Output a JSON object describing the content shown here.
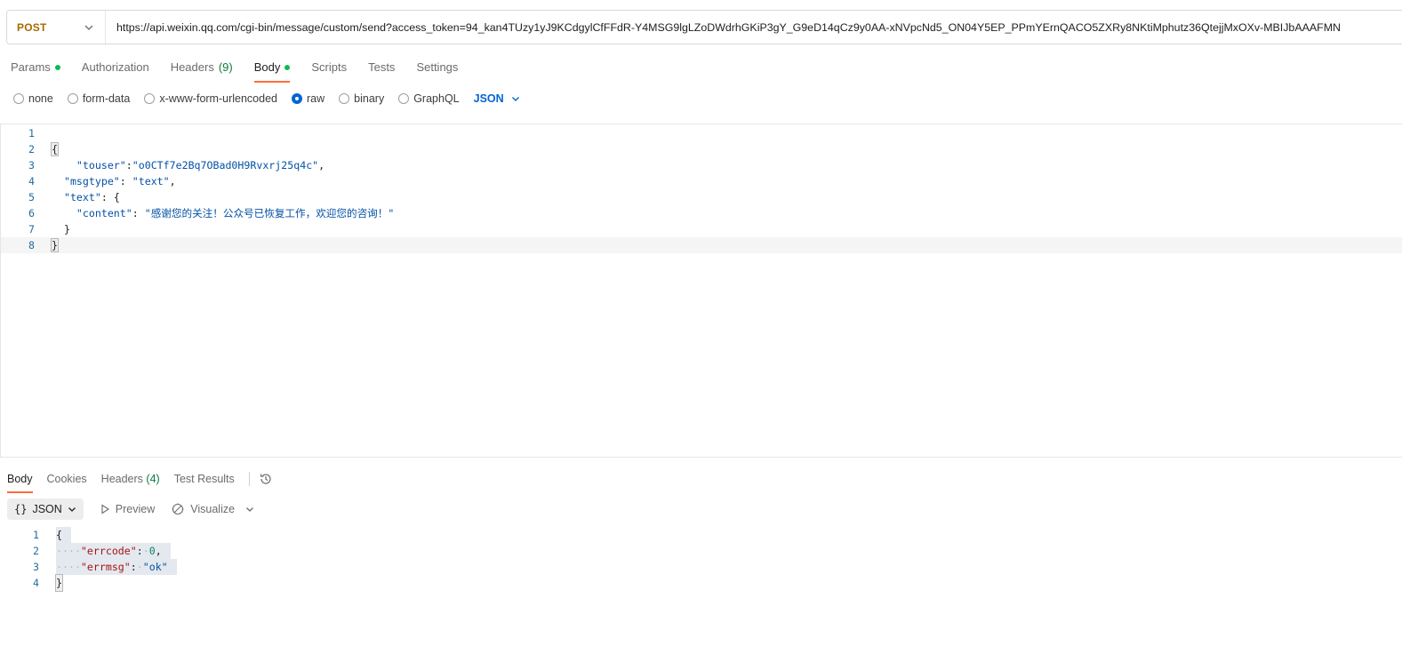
{
  "request": {
    "method": "POST",
    "url": "https://api.weixin.qq.com/cgi-bin/message/custom/send?access_token=94_kan4TUzy1yJ9KCdgylCfFFdR-Y4MSG9lgLZoDWdrhGKiP3gY_G9eD14qCz9y0AA-xNVpcNd5_ON04Y5EP_PPmYErnQACO5ZXRy8NKtiMphutz36QtejjMxOXv-MBIJbAAAFMN"
  },
  "request_tabs": [
    {
      "label": "Params",
      "dot": true
    },
    {
      "label": "Authorization"
    },
    {
      "label": "Headers",
      "count": "(9)"
    },
    {
      "label": "Body",
      "dot": true,
      "active": true
    },
    {
      "label": "Scripts"
    },
    {
      "label": "Tests"
    },
    {
      "label": "Settings"
    }
  ],
  "body_types": {
    "options": [
      "none",
      "form-data",
      "x-www-form-urlencoded",
      "raw",
      "binary",
      "GraphQL"
    ],
    "selected": "raw",
    "format": "JSON"
  },
  "editor": {
    "line_numbers": [
      "1",
      "2",
      "3",
      "4",
      "5",
      "6",
      "7",
      "8"
    ],
    "line3": {
      "key": "\"touser\"",
      "value": "\"o0CTf7e2Bq7OBad0H9Rvxrj25q4c\""
    },
    "line4": {
      "key": "\"msgtype\"",
      "value": "\"text\""
    },
    "line5": {
      "key": "\"text\""
    },
    "line6": {
      "key": "\"content\"",
      "value": "\"感谢您的关注！公众号已恢复工作，欢迎您的咨询！\""
    }
  },
  "response_tabs": [
    {
      "label": "Body",
      "active": true
    },
    {
      "label": "Cookies"
    },
    {
      "label": "Headers",
      "count": "(4)"
    },
    {
      "label": "Test Results"
    }
  ],
  "response_toolbar": {
    "format": "JSON",
    "preview": "Preview",
    "visualize": "Visualize"
  },
  "response": {
    "line_numbers": [
      "1",
      "2",
      "3",
      "4"
    ],
    "errcode_key": "\"errcode\"",
    "errcode_value": "0",
    "errmsg_key": "\"errmsg\"",
    "errmsg_value": "\"ok\""
  },
  "icons": {
    "method_chevron": "chevron-down-icon",
    "format_chevron": "chevron-down-icon",
    "history": "history-icon",
    "preview": "play-icon",
    "visualize": "visualize-icon"
  },
  "colors": {
    "method": "#a86b00",
    "accent": "#ff6c37",
    "active_dot": "#0cbb52",
    "link": "#0265d2"
  }
}
